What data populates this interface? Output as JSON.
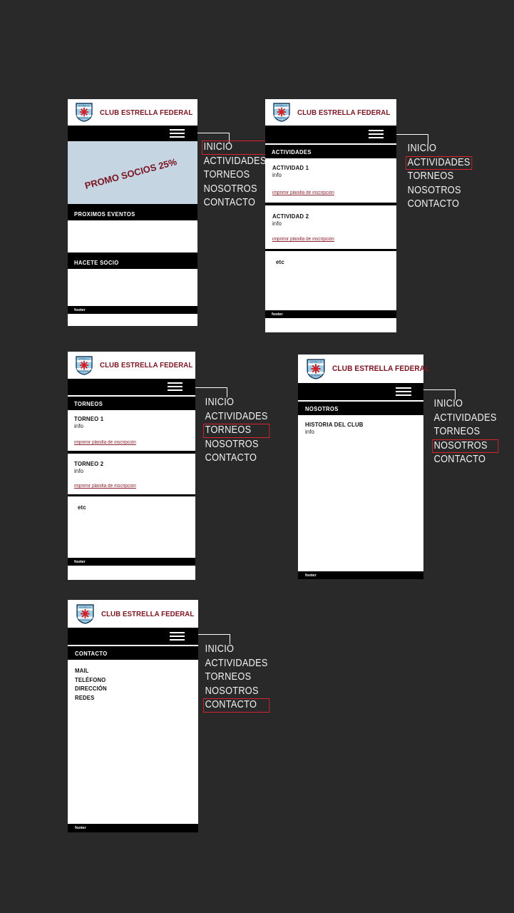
{
  "page": {
    "background_color": "#292929",
    "brand_name": "CLUB ESTRELLA FEDERAL",
    "accent_red": "#7a1420",
    "highlight_red": "#d9232d",
    "promo_blue": "#c6d5e2",
    "footer_label": "footer",
    "link_label": "imprimir planilla de inscripción",
    "info_label": "info",
    "etc_label": "etc"
  },
  "nav_menu": {
    "items": [
      "INICIO",
      "ACTIVIDADES",
      "TORNEOS",
      "NOSOTROS",
      "CONTACTO"
    ]
  },
  "screens": [
    {
      "id": "inicio",
      "active_menu": "INICIO",
      "promo": {
        "text": "PROMO SOCIOS 25%"
      },
      "sections": [
        {
          "title": "PROXIMOS EVENTOS"
        },
        {
          "title": "HACETE SOCIO"
        }
      ]
    },
    {
      "id": "actividades",
      "active_menu": "ACTIVIDADES",
      "section_title": "ACTIVIDADES",
      "cards": [
        {
          "title": "ACTIVIDAD 1",
          "sub": "info",
          "link": "imprimir planilla de inscripción"
        },
        {
          "title": "ACTIVIDAD 2",
          "sub": "info",
          "link": "imprimir planilla de inscripción"
        },
        {
          "title": "etc"
        }
      ]
    },
    {
      "id": "torneos",
      "active_menu": "TORNEOS",
      "section_title": "TORNEOS",
      "cards": [
        {
          "title": "TORNEO 1",
          "sub": "info",
          "link": "imprimir planilla de inscripción"
        },
        {
          "title": "TORNEO 2",
          "sub": "info",
          "link": "imprimir planilla de inscripción"
        },
        {
          "title": "etc"
        }
      ]
    },
    {
      "id": "nosotros",
      "active_menu": "NOSOTROS",
      "section_title": "NOSOTROS",
      "cards": [
        {
          "title": "HISTORIA DEL CLUB",
          "sub": "info"
        }
      ]
    },
    {
      "id": "contacto",
      "active_menu": "CONTACTO",
      "section_title": "CONTACTO",
      "contact_items": [
        "MAIL",
        "TELÉFONO",
        "DIRECCIÓN",
        "REDES"
      ]
    }
  ]
}
